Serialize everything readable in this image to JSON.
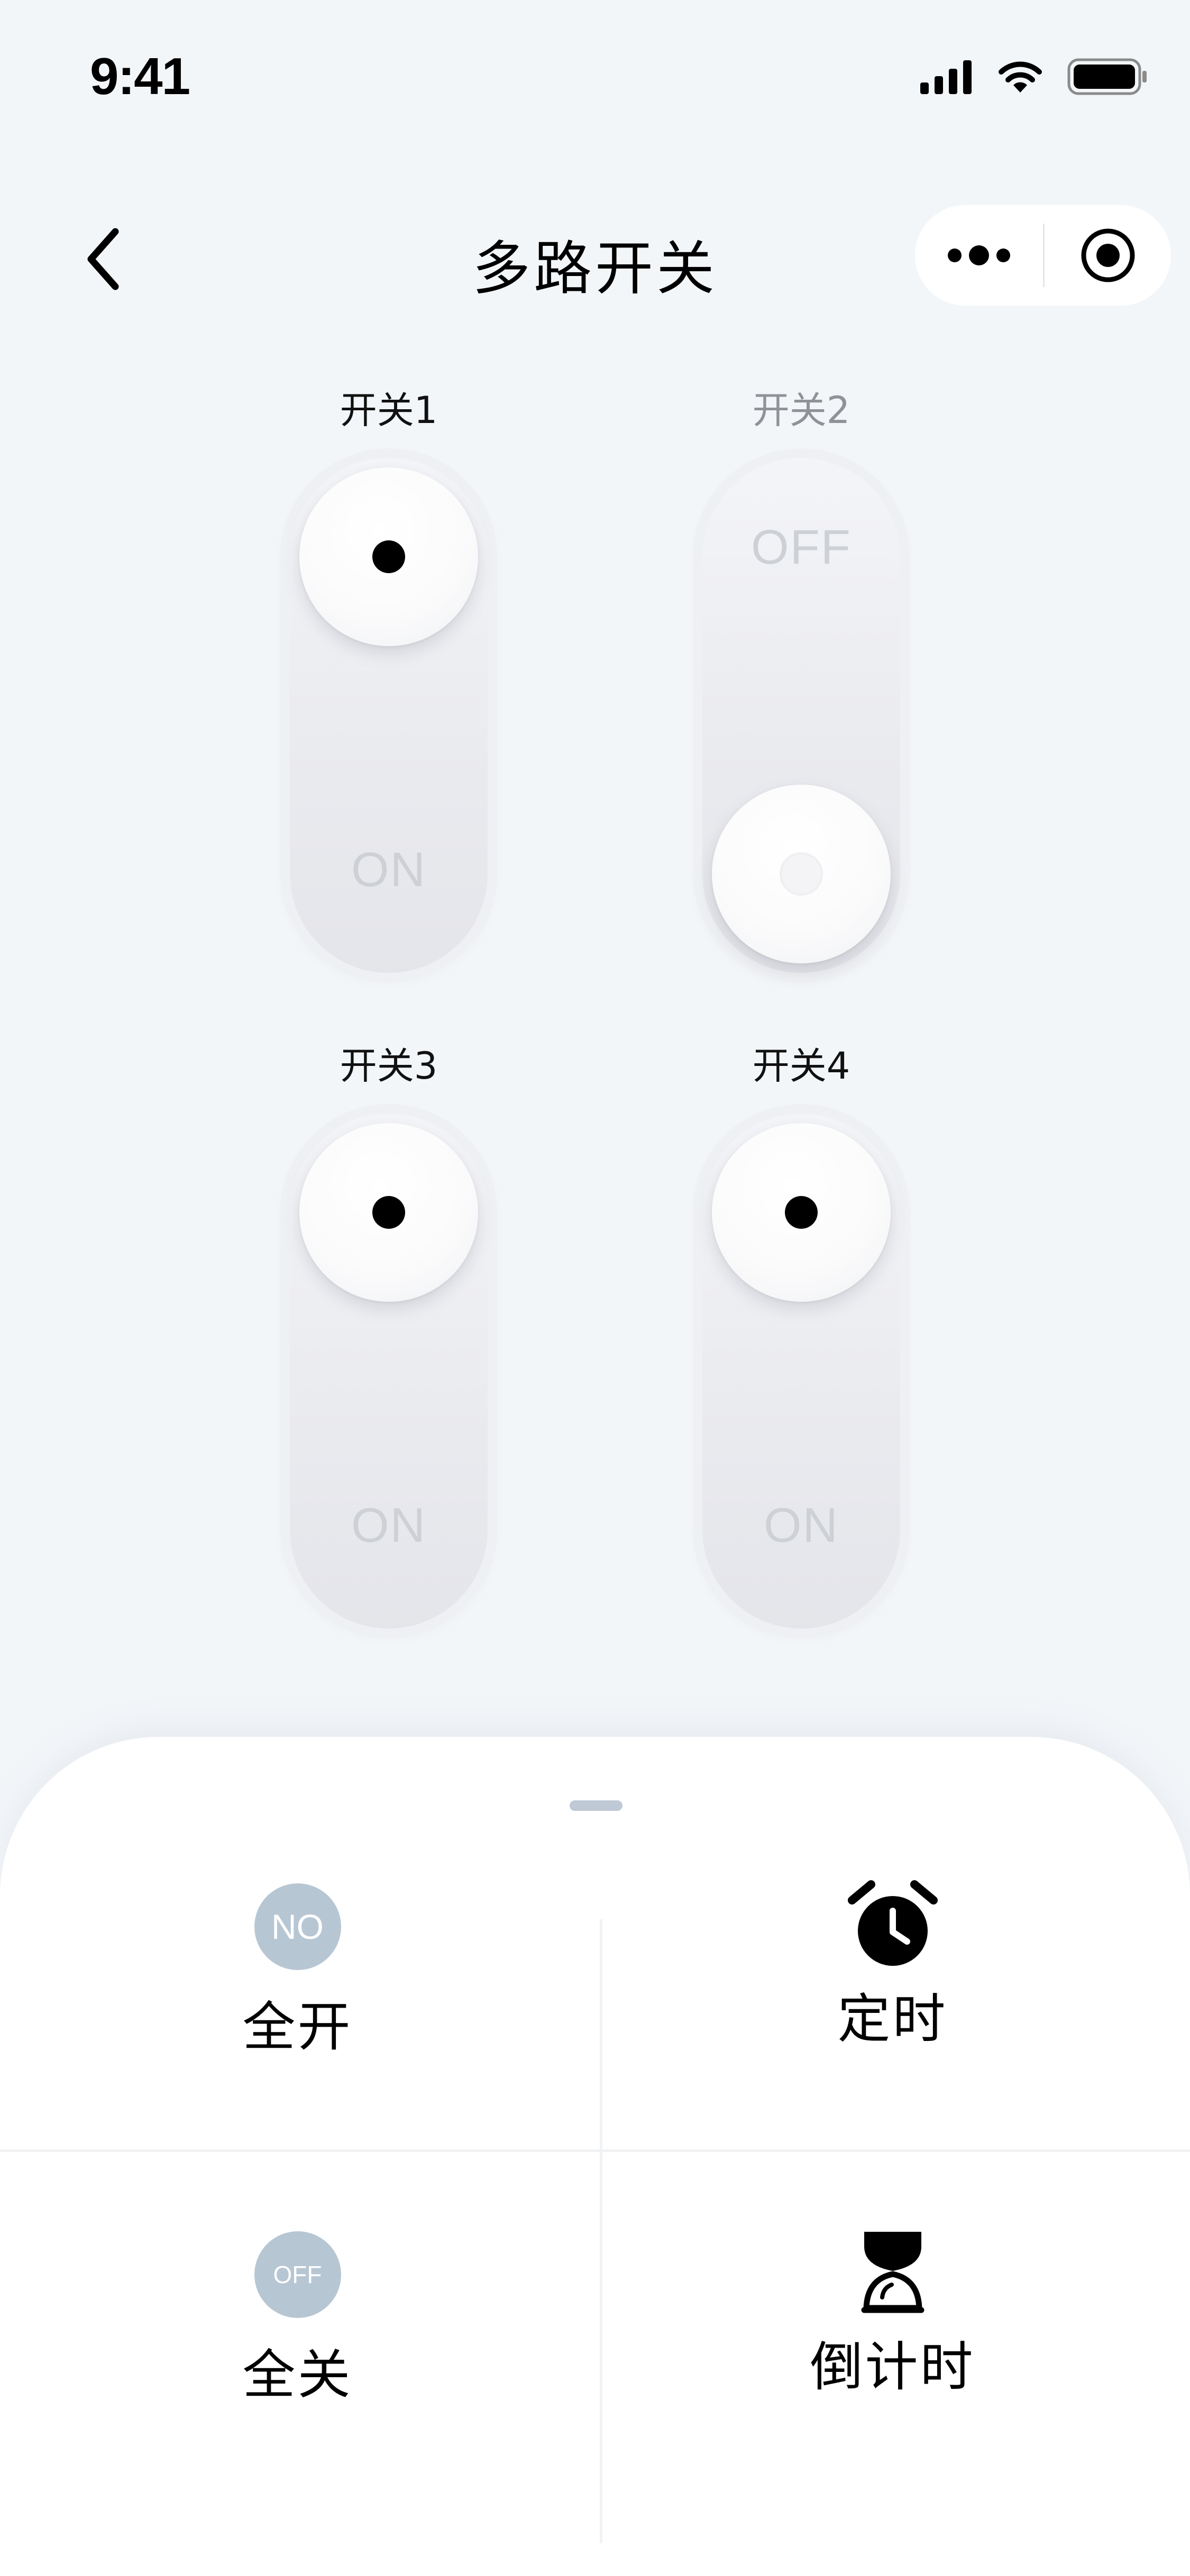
{
  "status_bar": {
    "time": "9:41"
  },
  "nav": {
    "title": "多路开关"
  },
  "switches": [
    {
      "label": "开关1",
      "state": "on",
      "track_text": "ON"
    },
    {
      "label": "开关2",
      "state": "off",
      "track_text": "OFF"
    },
    {
      "label": "开关3",
      "state": "on",
      "track_text": "ON"
    },
    {
      "label": "开关4",
      "state": "on",
      "track_text": "ON"
    }
  ],
  "actions": {
    "all_on": {
      "label": "全开",
      "badge": "NO"
    },
    "timer": {
      "label": "定时"
    },
    "all_off": {
      "label": "全关",
      "badge": "OFF"
    },
    "countdown": {
      "label": "倒计时"
    }
  },
  "colors": {
    "background": "#f3f6f9",
    "badge": "#b7c6d3",
    "handle": "#bfc9d6"
  }
}
